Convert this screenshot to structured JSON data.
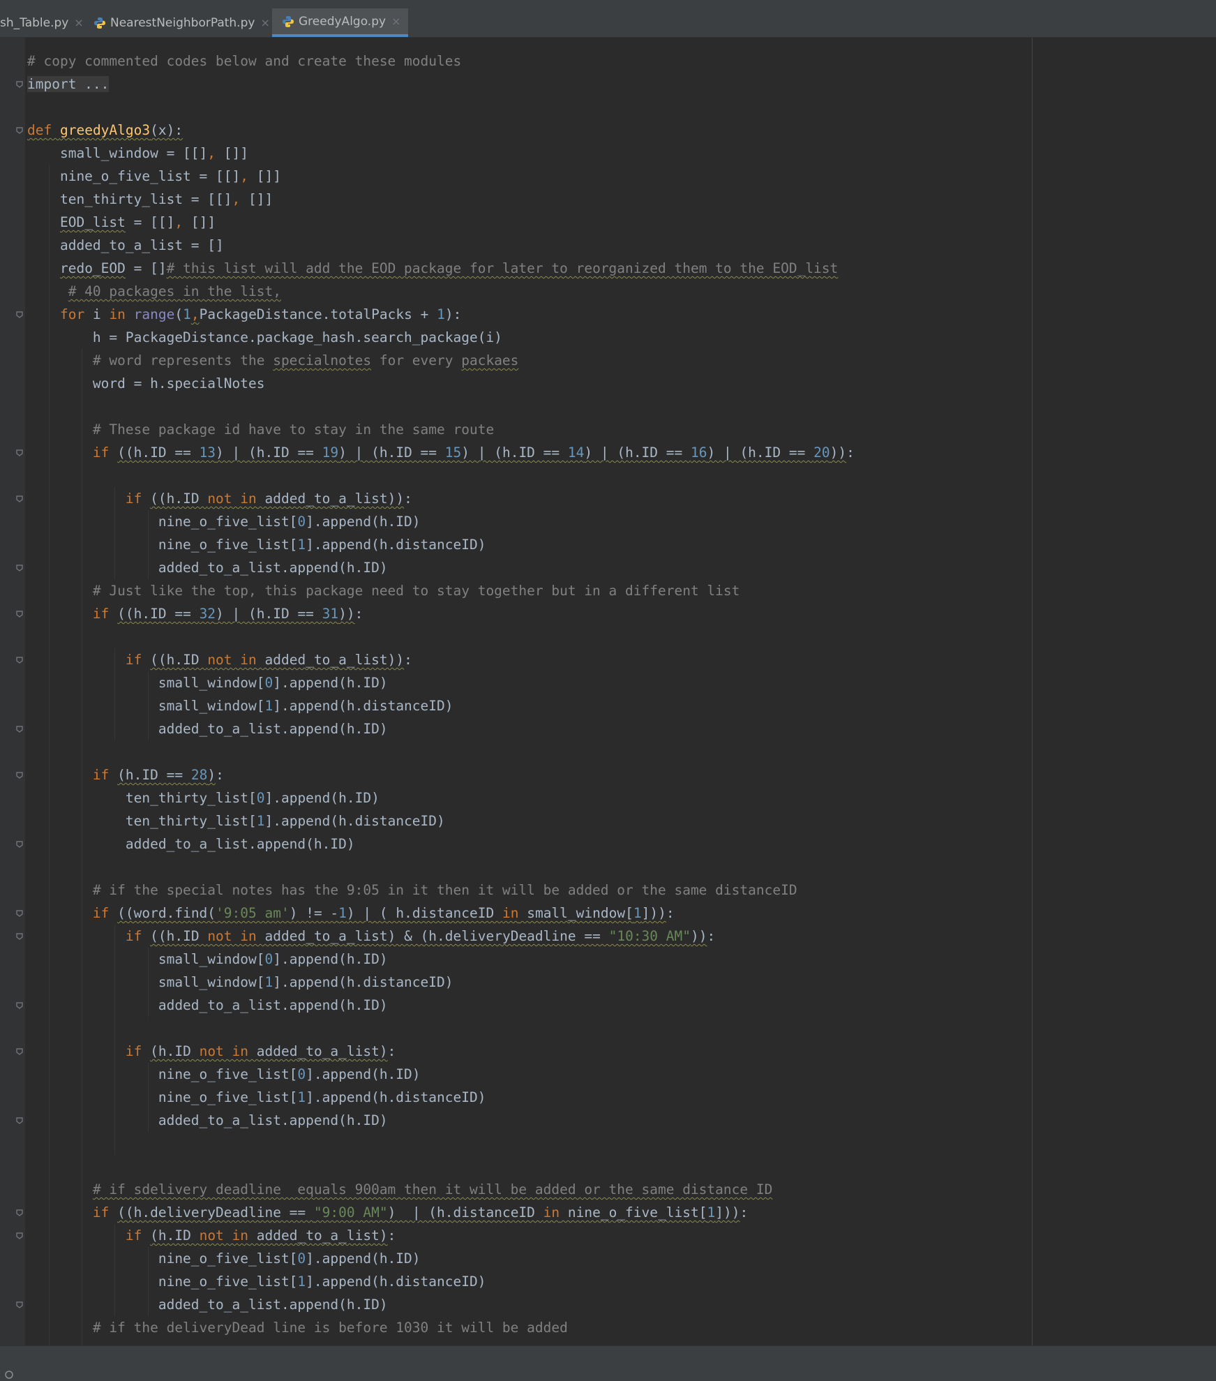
{
  "tabs": [
    {
      "label": "sh_Table.py",
      "active": false
    },
    {
      "label": "NearestNeighborPath.py",
      "active": false
    },
    {
      "label": "GreedyAlgo.py",
      "active": true
    }
  ],
  "tab_close_glyph": "×",
  "icons": {
    "tab_file_icon": "python-file-icon",
    "fold_marker": "fold-marker-icon",
    "status_icon": "status-bar-icon"
  },
  "colors": {
    "keyword": "#cc7832",
    "function": "#ffc66d",
    "number": "#6897bb",
    "comment": "#808080",
    "string": "#6a8759",
    "builtin": "#8888c6",
    "text": "#a9b7c6",
    "background": "#2b2b2b",
    "active_tab_underline": "#4a88c7"
  },
  "code": {
    "lines": [
      [
        {
          "t": "# copy commented codes below and create these modules",
          "c": "cm"
        }
      ],
      [
        {
          "t": "import ...",
          "c": "collapsed"
        }
      ],
      [],
      [
        {
          "t": "def",
          "c": "kw wavy"
        },
        {
          "t": " ",
          "c": "wavy"
        },
        {
          "t": "greedyAlgo3",
          "c": "fn wavy"
        },
        {
          "t": "(x):",
          "c": "wavy"
        }
      ],
      [
        {
          "t": "    small_window = [[]"
        },
        {
          "t": ",",
          "c": "kw"
        },
        {
          "t": " []]"
        }
      ],
      [
        {
          "t": "    nine_o_five_list = [[]"
        },
        {
          "t": ",",
          "c": "kw"
        },
        {
          "t": " []]"
        }
      ],
      [
        {
          "t": "    ten_thirty_list = [[]"
        },
        {
          "t": ",",
          "c": "kw"
        },
        {
          "t": " []]"
        }
      ],
      [
        {
          "t": "    "
        },
        {
          "t": "EOD_list",
          "c": "wavy"
        },
        {
          "t": " = [[]"
        },
        {
          "t": ",",
          "c": "kw"
        },
        {
          "t": " []]"
        }
      ],
      [
        {
          "t": "    added_to_a_list = []"
        }
      ],
      [
        {
          "t": "    "
        },
        {
          "t": "redo_EOD",
          "c": "wavy"
        },
        {
          "t": " = []"
        },
        {
          "t": "# this list will add the EOD package for later to reorganized them to the EOD_list",
          "c": "cm wavy"
        }
      ],
      [
        {
          "t": "     "
        },
        {
          "t": "# 40 packages in the list,",
          "c": "cm wavy"
        }
      ],
      [
        {
          "t": "    "
        },
        {
          "t": "for",
          "c": "kw"
        },
        {
          "t": " i "
        },
        {
          "t": "in",
          "c": "kw"
        },
        {
          "t": " "
        },
        {
          "t": "range",
          "c": "bi"
        },
        {
          "t": "("
        },
        {
          "t": "1",
          "c": "num"
        },
        {
          "t": ",",
          "c": "kw wavy"
        },
        {
          "t": "PackageDistance.totalPacks + "
        },
        {
          "t": "1",
          "c": "num"
        },
        {
          "t": "):"
        }
      ],
      [
        {
          "t": "        h = PackageDistance.package_hash.search_package(i)"
        }
      ],
      [
        {
          "t": "        "
        },
        {
          "t": "# word represents the ",
          "c": "cm"
        },
        {
          "t": "specialnotes",
          "c": "cm wavy"
        },
        {
          "t": " for every ",
          "c": "cm"
        },
        {
          "t": "packaes",
          "c": "cm wavy"
        }
      ],
      [
        {
          "t": "        word = h.specialNotes"
        }
      ],
      [],
      [
        {
          "t": "        "
        },
        {
          "t": "# These package id have to stay in the same route",
          "c": "cm"
        }
      ],
      [
        {
          "t": "        "
        },
        {
          "t": "if",
          "c": "kw"
        },
        {
          "t": " "
        },
        {
          "t": "((h.ID == ",
          "c": "wavy"
        },
        {
          "t": "13",
          "c": "num wavy"
        },
        {
          "t": ") | (h.ID == ",
          "c": "wavy"
        },
        {
          "t": "19",
          "c": "num wavy"
        },
        {
          "t": ") | (h.ID == ",
          "c": "wavy"
        },
        {
          "t": "15",
          "c": "num wavy"
        },
        {
          "t": ") | (h.ID == ",
          "c": "wavy"
        },
        {
          "t": "14",
          "c": "num wavy"
        },
        {
          "t": ") | (h.ID == ",
          "c": "wavy"
        },
        {
          "t": "16",
          "c": "num wavy"
        },
        {
          "t": ") | (h.ID == ",
          "c": "wavy"
        },
        {
          "t": "20",
          "c": "num wavy"
        },
        {
          "t": "))",
          "c": "wavy"
        },
        {
          "t": ":"
        }
      ],
      [],
      [
        {
          "t": "            "
        },
        {
          "t": "if",
          "c": "kw"
        },
        {
          "t": " "
        },
        {
          "t": "((h.ID ",
          "c": "wavy"
        },
        {
          "t": "not in",
          "c": "kw wavy"
        },
        {
          "t": " added_to_a_list))",
          "c": "wavy"
        },
        {
          "t": ":"
        }
      ],
      [
        {
          "t": "                nine_o_five_list["
        },
        {
          "t": "0",
          "c": "num"
        },
        {
          "t": "].append(h.ID)"
        }
      ],
      [
        {
          "t": "                nine_o_five_list["
        },
        {
          "t": "1",
          "c": "num"
        },
        {
          "t": "].append(h.distanceID)"
        }
      ],
      [
        {
          "t": "                added_to_a_list.append(h.ID)"
        }
      ],
      [
        {
          "t": "        "
        },
        {
          "t": "# Just like the top, this package need to stay together but in a different list",
          "c": "cm"
        }
      ],
      [
        {
          "t": "        "
        },
        {
          "t": "if",
          "c": "kw"
        },
        {
          "t": " "
        },
        {
          "t": "((h.ID == ",
          "c": "wavy"
        },
        {
          "t": "32",
          "c": "num wavy"
        },
        {
          "t": ") | (h.ID == ",
          "c": "wavy"
        },
        {
          "t": "31",
          "c": "num wavy"
        },
        {
          "t": "))",
          "c": "wavy"
        },
        {
          "t": ":"
        }
      ],
      [],
      [
        {
          "t": "            "
        },
        {
          "t": "if",
          "c": "kw"
        },
        {
          "t": " "
        },
        {
          "t": "((h.ID ",
          "c": "wavy"
        },
        {
          "t": "not in",
          "c": "kw wavy"
        },
        {
          "t": " added_to_a_list))",
          "c": "wavy"
        },
        {
          "t": ":"
        }
      ],
      [
        {
          "t": "                small_window["
        },
        {
          "t": "0",
          "c": "num"
        },
        {
          "t": "].append(h.ID)"
        }
      ],
      [
        {
          "t": "                small_window["
        },
        {
          "t": "1",
          "c": "num"
        },
        {
          "t": "].append(h.distanceID)"
        }
      ],
      [
        {
          "t": "                added_to_a_list.append(h.ID)"
        }
      ],
      [],
      [
        {
          "t": "        "
        },
        {
          "t": "if",
          "c": "kw"
        },
        {
          "t": " "
        },
        {
          "t": "(h.ID == ",
          "c": "wavy"
        },
        {
          "t": "28",
          "c": "num wavy"
        },
        {
          "t": ")",
          "c": "wavy"
        },
        {
          "t": ":"
        }
      ],
      [
        {
          "t": "            ten_thirty_list["
        },
        {
          "t": "0",
          "c": "num"
        },
        {
          "t": "].append(h.ID)"
        }
      ],
      [
        {
          "t": "            ten_thirty_list["
        },
        {
          "t": "1",
          "c": "num"
        },
        {
          "t": "].append(h.distanceID)"
        }
      ],
      [
        {
          "t": "            added_to_a_list.append(h.ID)"
        }
      ],
      [],
      [
        {
          "t": "        "
        },
        {
          "t": "# if the special notes has the 9:05 in it then it will be added or the same distanceID",
          "c": "cm"
        }
      ],
      [
        {
          "t": "        "
        },
        {
          "t": "if",
          "c": "kw"
        },
        {
          "t": " "
        },
        {
          "t": "((word.find(",
          "c": "wavy"
        },
        {
          "t": "'9:05 am'",
          "c": "str wavy"
        },
        {
          "t": ") != -",
          "c": "wavy"
        },
        {
          "t": "1",
          "c": "num wavy"
        },
        {
          "t": ") | ( h.distanceID ",
          "c": "wavy"
        },
        {
          "t": "in",
          "c": "kw wavy"
        },
        {
          "t": " small_window[",
          "c": "wavy"
        },
        {
          "t": "1",
          "c": "num wavy"
        },
        {
          "t": "]))",
          "c": "wavy"
        },
        {
          "t": ":"
        }
      ],
      [
        {
          "t": "            "
        },
        {
          "t": "if",
          "c": "kw"
        },
        {
          "t": " "
        },
        {
          "t": "((h.ID ",
          "c": "wavy"
        },
        {
          "t": "not in",
          "c": "kw wavy"
        },
        {
          "t": " added_to_a_list) & (h.deliveryDeadline == ",
          "c": "wavy"
        },
        {
          "t": "\"10:30 AM\"",
          "c": "str wavy"
        },
        {
          "t": "))",
          "c": "wavy"
        },
        {
          "t": ":"
        }
      ],
      [
        {
          "t": "                small_window["
        },
        {
          "t": "0",
          "c": "num"
        },
        {
          "t": "].append(h.ID)"
        }
      ],
      [
        {
          "t": "                small_window["
        },
        {
          "t": "1",
          "c": "num"
        },
        {
          "t": "].append(h.distanceID)"
        }
      ],
      [
        {
          "t": "                added_to_a_list.append(h.ID)"
        }
      ],
      [],
      [
        {
          "t": "            "
        },
        {
          "t": "if",
          "c": "kw"
        },
        {
          "t": " "
        },
        {
          "t": "(h.ID ",
          "c": "wavy"
        },
        {
          "t": "not in",
          "c": "kw wavy"
        },
        {
          "t": " added_to_a_list)",
          "c": "wavy"
        },
        {
          "t": ":"
        }
      ],
      [
        {
          "t": "                nine_o_five_list["
        },
        {
          "t": "0",
          "c": "num"
        },
        {
          "t": "].append(h.ID)"
        }
      ],
      [
        {
          "t": "                nine_o_five_list["
        },
        {
          "t": "1",
          "c": "num"
        },
        {
          "t": "].append(h.distanceID)"
        }
      ],
      [
        {
          "t": "                added_to_a_list.append(h.ID)"
        }
      ],
      [],
      [],
      [
        {
          "t": "        "
        },
        {
          "t": "# if sdelivery deadline  equals 900am then it will be added or the same distance ID",
          "c": "cm wavy"
        }
      ],
      [
        {
          "t": "        "
        },
        {
          "t": "if",
          "c": "kw"
        },
        {
          "t": " "
        },
        {
          "t": "((h.deliveryDeadline == ",
          "c": "wavy"
        },
        {
          "t": "\"9:00 AM\"",
          "c": "str wavy"
        },
        {
          "t": ")  | (h.distanceID ",
          "c": "wavy"
        },
        {
          "t": "in",
          "c": "kw wavy"
        },
        {
          "t": " nine_o_five_list[",
          "c": "wavy"
        },
        {
          "t": "1",
          "c": "num wavy"
        },
        {
          "t": "]))",
          "c": "wavy"
        },
        {
          "t": ":"
        }
      ],
      [
        {
          "t": "            "
        },
        {
          "t": "if",
          "c": "kw"
        },
        {
          "t": " "
        },
        {
          "t": "(h.ID ",
          "c": "wavy"
        },
        {
          "t": "not in",
          "c": "kw wavy"
        },
        {
          "t": " added_to_a_list)",
          "c": "wavy"
        },
        {
          "t": ":"
        }
      ],
      [
        {
          "t": "                nine_o_five_list["
        },
        {
          "t": "0",
          "c": "num"
        },
        {
          "t": "].append(h.ID)"
        }
      ],
      [
        {
          "t": "                nine_o_five_list["
        },
        {
          "t": "1",
          "c": "num"
        },
        {
          "t": "].append(h.distanceID)"
        }
      ],
      [
        {
          "t": "                added_to_a_list.append(h.ID)"
        }
      ],
      [
        {
          "t": "        "
        },
        {
          "t": "# if the deliveryDead line is before 1030 it will be added",
          "c": "cm"
        }
      ]
    ]
  }
}
